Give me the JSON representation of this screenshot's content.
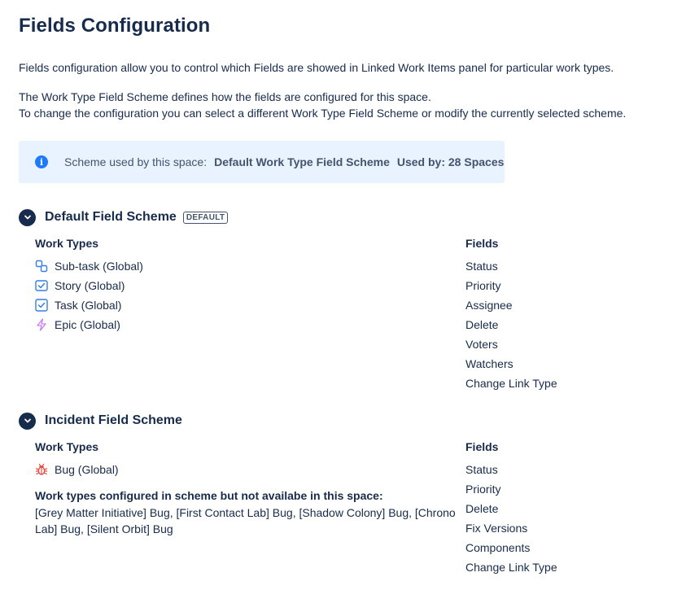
{
  "page": {
    "title": "Fields Configuration",
    "intro": "Fields configuration allow you to control which Fields are showed in Linked Work Items panel for particular work types.",
    "description_line1": "The Work Type Field Scheme defines how the fields are configured for this space.",
    "description_line2": "To change the configuration you can select a different Work Type Field Scheme or modify the currently selected scheme."
  },
  "info": {
    "icon": "info-icon",
    "label": "Scheme used by this space:",
    "scheme_name": "Default Work Type Field Scheme",
    "used_by": "Used by: 28 Spaces"
  },
  "schemes": [
    {
      "name": "Default Field Scheme",
      "badge": "DEFAULT",
      "work_types_header": "Work Types",
      "fields_header": "Fields",
      "work_types": [
        {
          "label": "Sub-task (Global)",
          "icon": "subtask-icon"
        },
        {
          "label": "Story (Global)",
          "icon": "story-icon"
        },
        {
          "label": "Task (Global)",
          "icon": "task-icon"
        },
        {
          "label": "Epic (Global)",
          "icon": "epic-icon"
        }
      ],
      "fields": [
        "Status",
        "Priority",
        "Assignee",
        "Delete",
        "Voters",
        "Watchers",
        "Change Link Type"
      ]
    },
    {
      "name": "Incident Field Scheme",
      "work_types_header": "Work Types",
      "fields_header": "Fields",
      "work_types": [
        {
          "label": "Bug (Global)",
          "icon": "bug-icon"
        }
      ],
      "unavailable_title": "Work types configured in scheme but not availabe in this space:",
      "unavailable_list": "[Grey Matter Initiative] Bug, [First Contact Lab] Bug, [Shadow Colony] Bug, [Chrono Lab] Bug, [Silent Orbit] Bug",
      "fields": [
        "Status",
        "Priority",
        "Delete",
        "Fix Versions",
        "Components",
        "Change Link Type"
      ]
    }
  ],
  "colors": {
    "text": "#172b4d",
    "info_bg": "#e9f2ff",
    "info_icon": "#1d7afc",
    "subtask": "#357de8",
    "story": "#357de8",
    "epic": "#c97cf4",
    "bug": "#e2483d"
  }
}
